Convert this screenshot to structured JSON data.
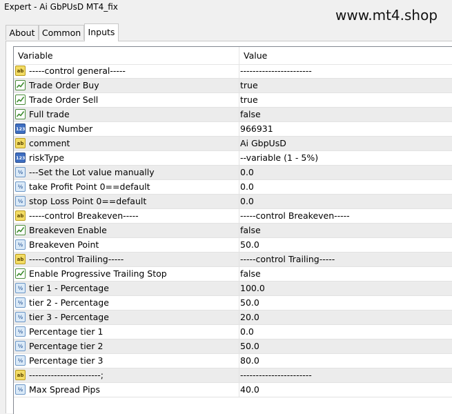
{
  "window": {
    "title": "Expert - Ai GbPUsD MT4_fix"
  },
  "watermark": "www.mt4.shop",
  "tabs": [
    {
      "label": "About",
      "active": false
    },
    {
      "label": "Common",
      "active": false
    },
    {
      "label": "Inputs",
      "active": true
    }
  ],
  "table": {
    "headers": {
      "variable": "Variable",
      "value": "Value"
    },
    "rows": [
      {
        "icon": "ab",
        "name": "-----control general-----",
        "value": "-----------------------"
      },
      {
        "icon": "bool",
        "name": "Trade Order Buy",
        "value": "true"
      },
      {
        "icon": "bool",
        "name": "Trade Order Sell",
        "value": "true"
      },
      {
        "icon": "bool",
        "name": "Full trade",
        "value": "false"
      },
      {
        "icon": "int",
        "name": "magic Number",
        "value": "966931"
      },
      {
        "icon": "ab",
        "name": "comment",
        "value": "Ai GbpUsD"
      },
      {
        "icon": "int",
        "name": "riskType",
        "value": "--variable (1 - 5%)"
      },
      {
        "icon": "dbl",
        "name": "---Set the Lot value manually",
        "value": "0.0"
      },
      {
        "icon": "dbl",
        "name": "take Profit Point 0==default",
        "value": "0.0"
      },
      {
        "icon": "dbl",
        "name": "stop Loss Point  0==default",
        "value": "0.0"
      },
      {
        "icon": "ab",
        "name": "-----control Breakeven-----",
        "value": "-----control Breakeven-----"
      },
      {
        "icon": "bool",
        "name": "Breakeven Enable",
        "value": "false"
      },
      {
        "icon": "dbl",
        "name": "Breakeven Point",
        "value": "50.0"
      },
      {
        "icon": "ab",
        "name": "-----control Trailing-----",
        "value": "-----control Trailing-----"
      },
      {
        "icon": "bool",
        "name": "Enable Progressive Trailing Stop",
        "value": "false"
      },
      {
        "icon": "dbl",
        "name": "tier 1 - Percentage",
        "value": "100.0"
      },
      {
        "icon": "dbl",
        "name": "tier 2 - Percentage",
        "value": "50.0"
      },
      {
        "icon": "dbl",
        "name": "tier 3 - Percentage",
        "value": "20.0"
      },
      {
        "icon": "dbl",
        "name": "Percentage tier 1",
        "value": "0.0"
      },
      {
        "icon": "dbl",
        "name": "Percentage tier 2",
        "value": "50.0"
      },
      {
        "icon": "dbl",
        "name": "Percentage tier 3",
        "value": "80.0"
      },
      {
        "icon": "ab",
        "name": "-----------------------;",
        "value": "-----------------------"
      },
      {
        "icon": "dbl",
        "name": "Max Spread Pips",
        "value": "40.0"
      }
    ]
  },
  "icons": {
    "ab": {
      "name": "string-type-icon",
      "glyph": "ab"
    },
    "bool": {
      "name": "bool-type-icon",
      "glyph": ""
    },
    "int": {
      "name": "integer-type-icon",
      "glyph": "123"
    },
    "dbl": {
      "name": "double-type-icon",
      "glyph": "½"
    }
  }
}
